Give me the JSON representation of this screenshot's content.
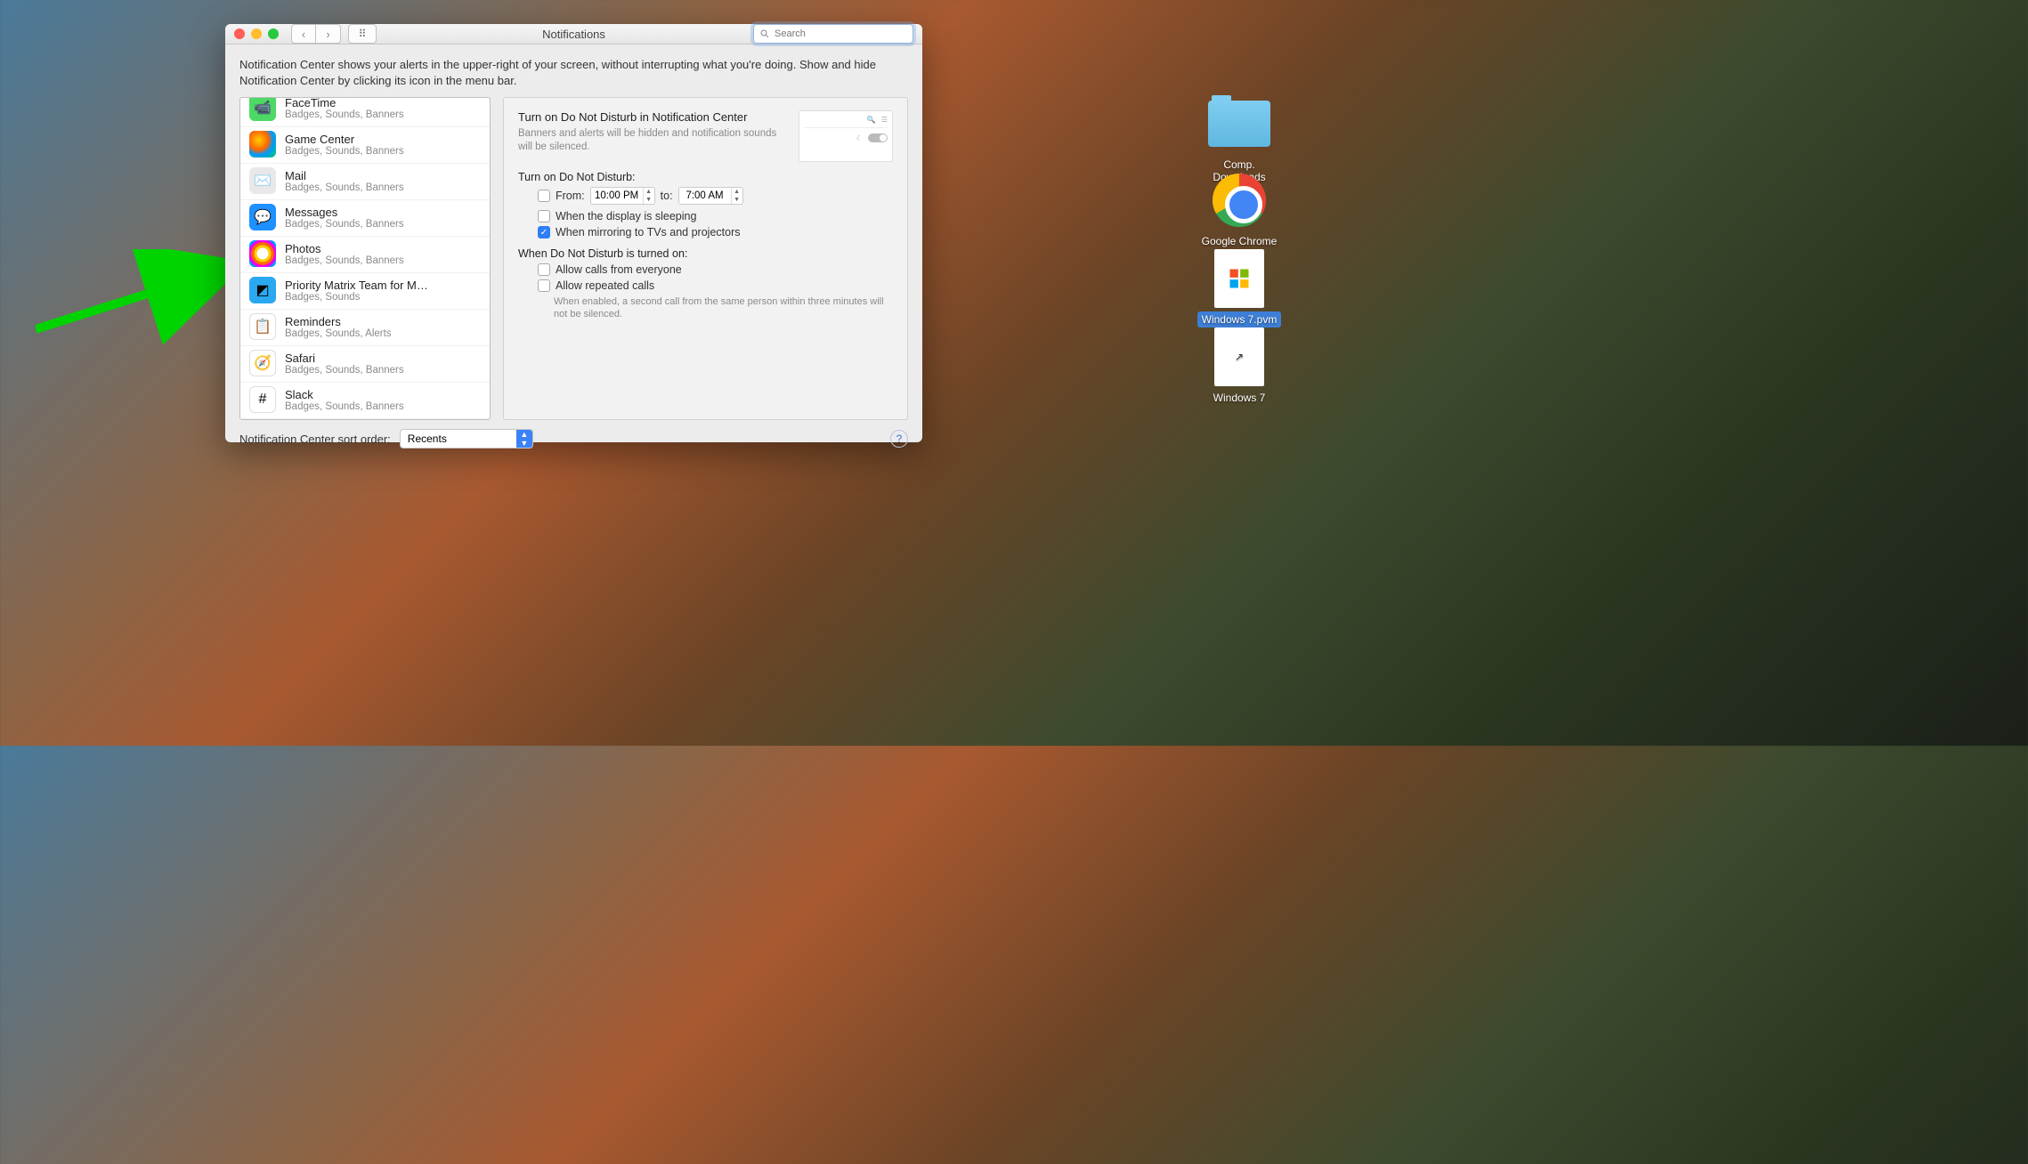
{
  "window": {
    "title": "Notifications",
    "search_placeholder": "Search",
    "intro": "Notification Center shows your alerts in the upper-right of your screen, without interrupting what you're doing. Show and hide Notification Center by clicking its icon in the menu bar."
  },
  "apps": [
    {
      "name": "FaceTime",
      "sub": "Badges, Sounds, Banners",
      "icon": "ic-ft"
    },
    {
      "name": "Game Center",
      "sub": "Badges, Sounds, Banners",
      "icon": "ic-gc"
    },
    {
      "name": "Mail",
      "sub": "Badges, Sounds, Banners",
      "icon": "ic-mail"
    },
    {
      "name": "Messages",
      "sub": "Badges, Sounds, Banners",
      "icon": "ic-msg"
    },
    {
      "name": "Photos",
      "sub": "Badges, Sounds, Banners",
      "icon": "ic-ph"
    },
    {
      "name": "Priority Matrix Team for M…",
      "sub": "Badges, Sounds",
      "icon": "ic-pm"
    },
    {
      "name": "Reminders",
      "sub": "Badges, Sounds, Alerts",
      "icon": "ic-rm"
    },
    {
      "name": "Safari",
      "sub": "Badges, Sounds, Banners",
      "icon": "ic-sf"
    },
    {
      "name": "Slack",
      "sub": "Badges, Sounds, Banners",
      "icon": "ic-sl"
    }
  ],
  "dnd": {
    "title": "Turn on Do Not Disturb in Notification Center",
    "desc": "Banners and alerts will be hidden and notification sounds will be silenced.",
    "section1": "Turn on Do Not Disturb:",
    "from_label": "From:",
    "from_time": "10:00 PM",
    "to_label": "to:",
    "to_time": "7:00 AM",
    "opt_sleep": "When the display is sleeping",
    "opt_mirror": "When mirroring to TVs and projectors",
    "section2": "When Do Not Disturb is turned on:",
    "opt_calls": "Allow calls from everyone",
    "opt_repeat": "Allow repeated calls",
    "repeat_hint": "When enabled, a second call from the same person within three minutes will not be silenced."
  },
  "footer": {
    "label": "Notification Center sort order:",
    "value": "Recents",
    "help": "?"
  },
  "desktop": {
    "folder": "Comp. Downloads",
    "chrome": "Google Chrome",
    "pvm": "Windows 7.pvm",
    "win7": "Windows 7"
  }
}
